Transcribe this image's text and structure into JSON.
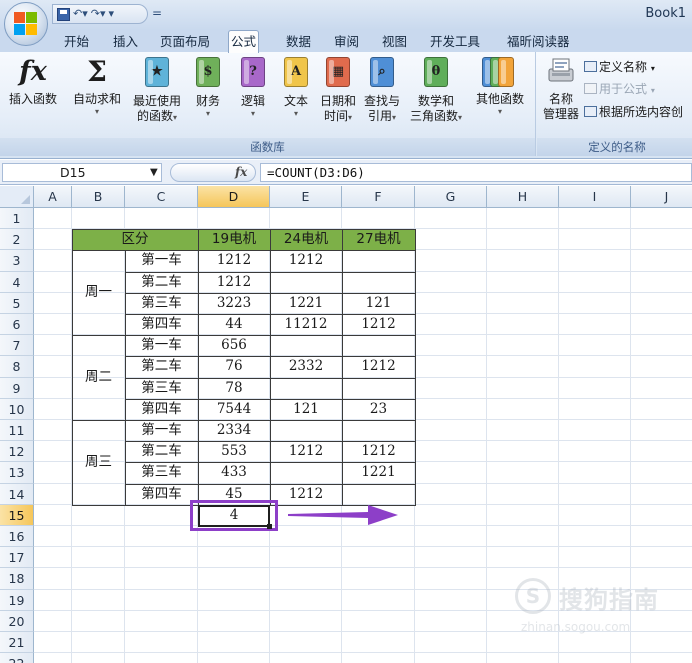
{
  "window": {
    "title": "Book1",
    "qat_extra": "="
  },
  "tabs": [
    {
      "label": "开始",
      "active": false
    },
    {
      "label": "插入",
      "active": false
    },
    {
      "label": "页面布局",
      "active": false
    },
    {
      "label": "公式",
      "active": true
    },
    {
      "label": "数据",
      "active": false
    },
    {
      "label": "审阅",
      "active": false
    },
    {
      "label": "视图",
      "active": false
    },
    {
      "label": "开发工具",
      "active": false
    },
    {
      "label": "福昕阅读器",
      "active": false
    }
  ],
  "ribbon": {
    "function_library": {
      "label": "函数库",
      "buttons": [
        {
          "line1": "插入函数",
          "line2": "",
          "icon": "fx-icon",
          "glyph": "fx"
        },
        {
          "line1": "自动求和",
          "line2": "",
          "icon": "sigma-icon",
          "glyph": "Σ"
        },
        {
          "line1": "最近使用",
          "line2": "的函数",
          "icon": "recent-book-icon",
          "glyph": "★"
        },
        {
          "line1": "财务",
          "line2": "",
          "icon": "finance-book-icon",
          "glyph": "$"
        },
        {
          "line1": "逻辑",
          "line2": "",
          "icon": "logic-book-icon",
          "glyph": "?"
        },
        {
          "line1": "文本",
          "line2": "",
          "icon": "text-book-icon",
          "glyph": "A"
        },
        {
          "line1": "日期和",
          "line2": "时间",
          "icon": "date-book-icon",
          "glyph": "▦"
        },
        {
          "line1": "查找与",
          "line2": "引用",
          "icon": "lookup-book-icon",
          "glyph": "⌕"
        },
        {
          "line1": "数学和",
          "line2": "三角函数",
          "icon": "math-book-icon",
          "glyph": "θ"
        },
        {
          "line1": "其他函数",
          "line2": "",
          "icon": "more-books-icon",
          "glyph": ""
        }
      ],
      "book_colors": [
        "#5fb3d9",
        "#6fb05a",
        "#a868c9",
        "#f0c54a",
        "#e06b4d",
        "#4f8fd6",
        "#5fae5a",
        "#f2a43a"
      ]
    },
    "defined_names": {
      "label": "定义的名称",
      "name_manager": {
        "line1": "名称",
        "line2": "管理器"
      },
      "define_name": "定义名称",
      "use_in_formula": "用于公式",
      "create_from_selection": "根据所选内容创"
    }
  },
  "formula_bar": {
    "name_box": "D15",
    "fx_label": "fx",
    "formula": "=COUNT(D3:D6)"
  },
  "sheet": {
    "columns": [
      "A",
      "B",
      "C",
      "D",
      "E",
      "F",
      "G",
      "H",
      "I",
      "J"
    ],
    "rows": [
      "1",
      "2",
      "3",
      "4",
      "5",
      "6",
      "7",
      "8",
      "9",
      "10",
      "11",
      "12",
      "13",
      "14",
      "15",
      "16",
      "17",
      "18",
      "19",
      "20",
      "21",
      "22"
    ],
    "selected_column": "D",
    "selected_row": "15",
    "header_fill": "#7db048",
    "table": {
      "header": [
        "区分",
        "19电机",
        "24电机",
        "27电机"
      ],
      "groups": [
        {
          "name": "周一",
          "rows": [
            {
              "car": "第一车",
              "d": "1212",
              "e": "1212",
              "f": ""
            },
            {
              "car": "第二车",
              "d": "1212",
              "e": "",
              "f": ""
            },
            {
              "car": "第三车",
              "d": "3223",
              "e": "1221",
              "f": "121"
            },
            {
              "car": "第四车",
              "d": "44",
              "e": "11212",
              "f": "1212"
            }
          ]
        },
        {
          "name": "周二",
          "rows": [
            {
              "car": "第一车",
              "d": "656",
              "e": "",
              "f": ""
            },
            {
              "car": "第二车",
              "d": "76",
              "e": "2332",
              "f": "1212"
            },
            {
              "car": "第三车",
              "d": "78",
              "e": "",
              "f": ""
            },
            {
              "car": "第四车",
              "d": "7544",
              "e": "121",
              "f": "23"
            }
          ]
        },
        {
          "name": "周三",
          "rows": [
            {
              "car": "第一车",
              "d": "2334",
              "e": "",
              "f": ""
            },
            {
              "car": "第二车",
              "d": "553",
              "e": "1212",
              "f": "1212"
            },
            {
              "car": "第三车",
              "d": "433",
              "e": "",
              "f": "1221"
            },
            {
              "car": "第四车",
              "d": "45",
              "e": "1212",
              "f": ""
            }
          ]
        }
      ],
      "result": "4"
    },
    "annotation_color": "#8d3fc8"
  },
  "watermark": {
    "logo": "S",
    "text": "搜狗指南",
    "url": "zhinan.sogou.com"
  }
}
